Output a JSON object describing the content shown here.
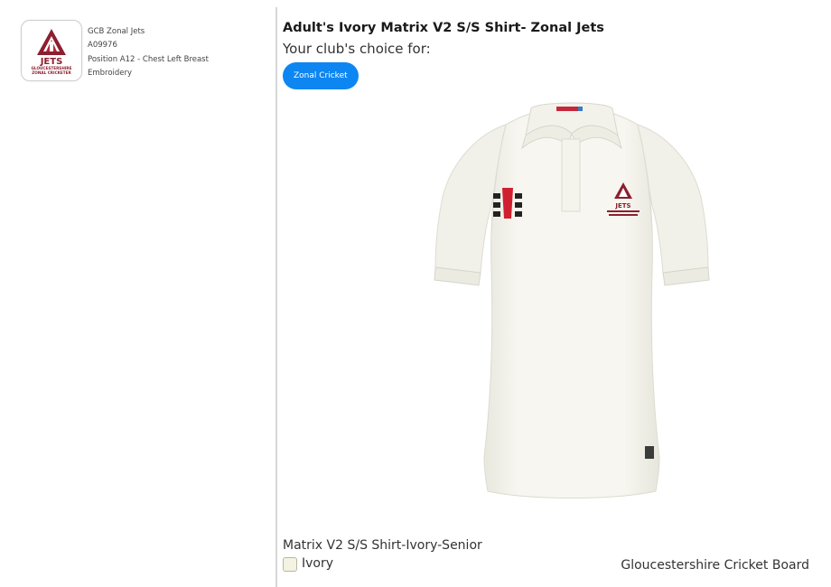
{
  "logo": {
    "brand_word": "JETS",
    "brand_line1": "GLOUCESTERSHIRE",
    "brand_line2": "ZONAL CRICKETER",
    "icon": "jets-triangle-logo"
  },
  "logo_details": {
    "name": "GCB Zonal Jets",
    "code": "A09976",
    "position": "Position A12 - Chest Left Breast",
    "method": "Embroidery"
  },
  "product": {
    "title": "Adult's Ivory Matrix V2 S/S Shirt- Zonal Jets",
    "club_choice_label": "Your club's choice for:",
    "choice_button": "Zonal Cricket",
    "variant_name": "Matrix V2 S/S Shirt-Ivory-Senior",
    "colour": "Ivory",
    "colour_hex": "#f4f2e2",
    "club": "Gloucestershire Cricket Board"
  },
  "colors": {
    "accent_blue": "#0d86f2",
    "brand_maroon": "#8c1f2f",
    "shirt_ivory": "#f6f5ee"
  }
}
